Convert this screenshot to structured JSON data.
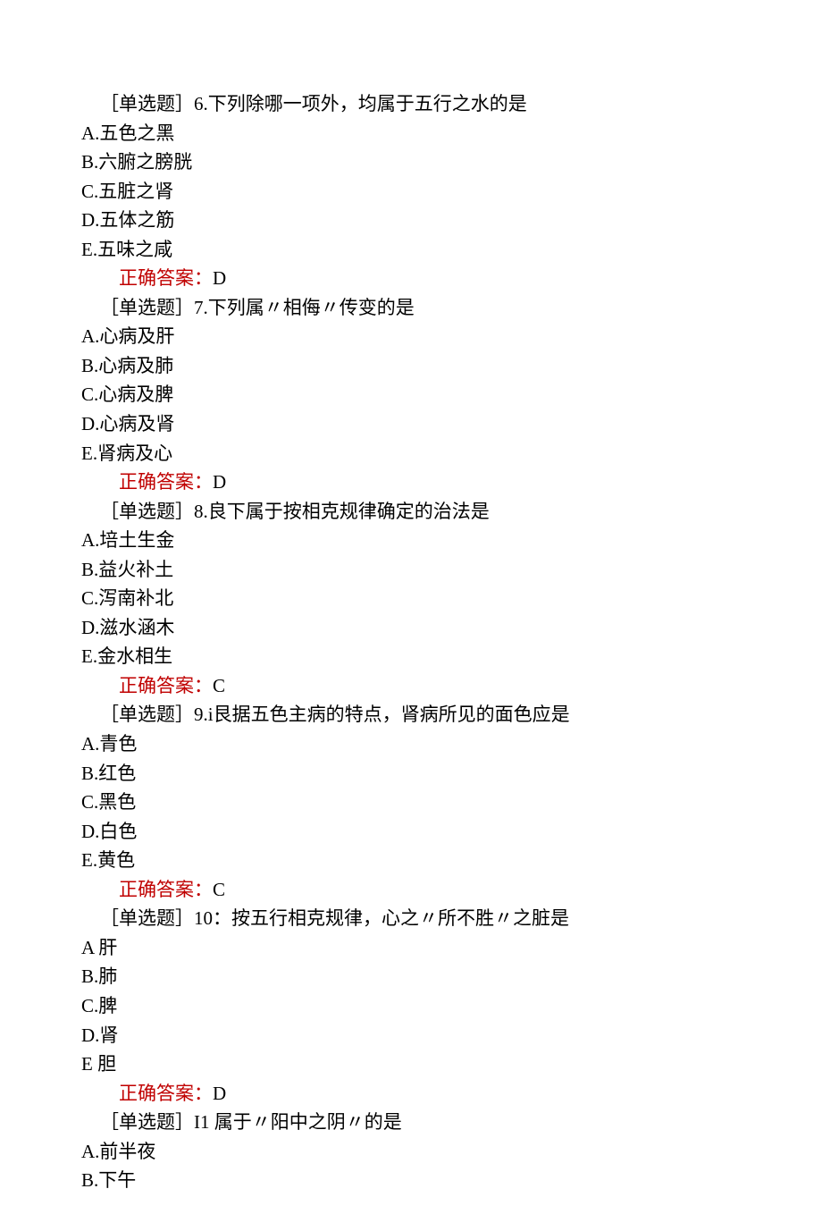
{
  "questions": [
    {
      "prefix": "［单选题］6.",
      "stem": "下列除哪一项外，均属于五行之水的是",
      "options": [
        "A.五色之黑",
        "B.六腑之膀胱",
        "C.五脏之肾",
        "D.五体之筋",
        "E.五味之咸"
      ],
      "answer_label": "正确答案：",
      "answer": "D"
    },
    {
      "prefix": "［单选题］7.",
      "stem": "下列属〃相侮〃传变的是",
      "options": [
        "A.心病及肝",
        "B.心病及肺",
        "C.心病及脾",
        "D.心病及肾",
        "E.肾病及心"
      ],
      "answer_label": "正确答案：",
      "answer": "D"
    },
    {
      "prefix": "［单选题］8.",
      "stem": "良下属于按相克规律确定的治法是",
      "options": [
        "A.培土生金",
        "B.益火补土",
        "C.泻南补北",
        "D.滋水涵木",
        "E.金水相生"
      ],
      "answer_label": "正确答案：",
      "answer": "C"
    },
    {
      "prefix": "［单选题］9.",
      "stem": "i艮据五色主病的特点，肾病所见的面色应是",
      "options": [
        "A.青色",
        "B.红色",
        "C.黑色",
        "D.白色",
        "E.黄色"
      ],
      "answer_label": "正确答案：",
      "answer": "C"
    },
    {
      "prefix": "［单选题］10：",
      "stem": "按五行相克规律，心之〃所不胜〃之脏是",
      "options": [
        "A 肝",
        "B.肺",
        "C.脾",
        "D.肾",
        "E 胆"
      ],
      "answer_label": "正确答案：",
      "answer": "D"
    },
    {
      "prefix": "［单选题］I1",
      "stem": " 属于〃阳中之阴〃的是",
      "options": [
        "A.前半夜",
        "B.下午"
      ],
      "answer_label": "",
      "answer": ""
    }
  ]
}
